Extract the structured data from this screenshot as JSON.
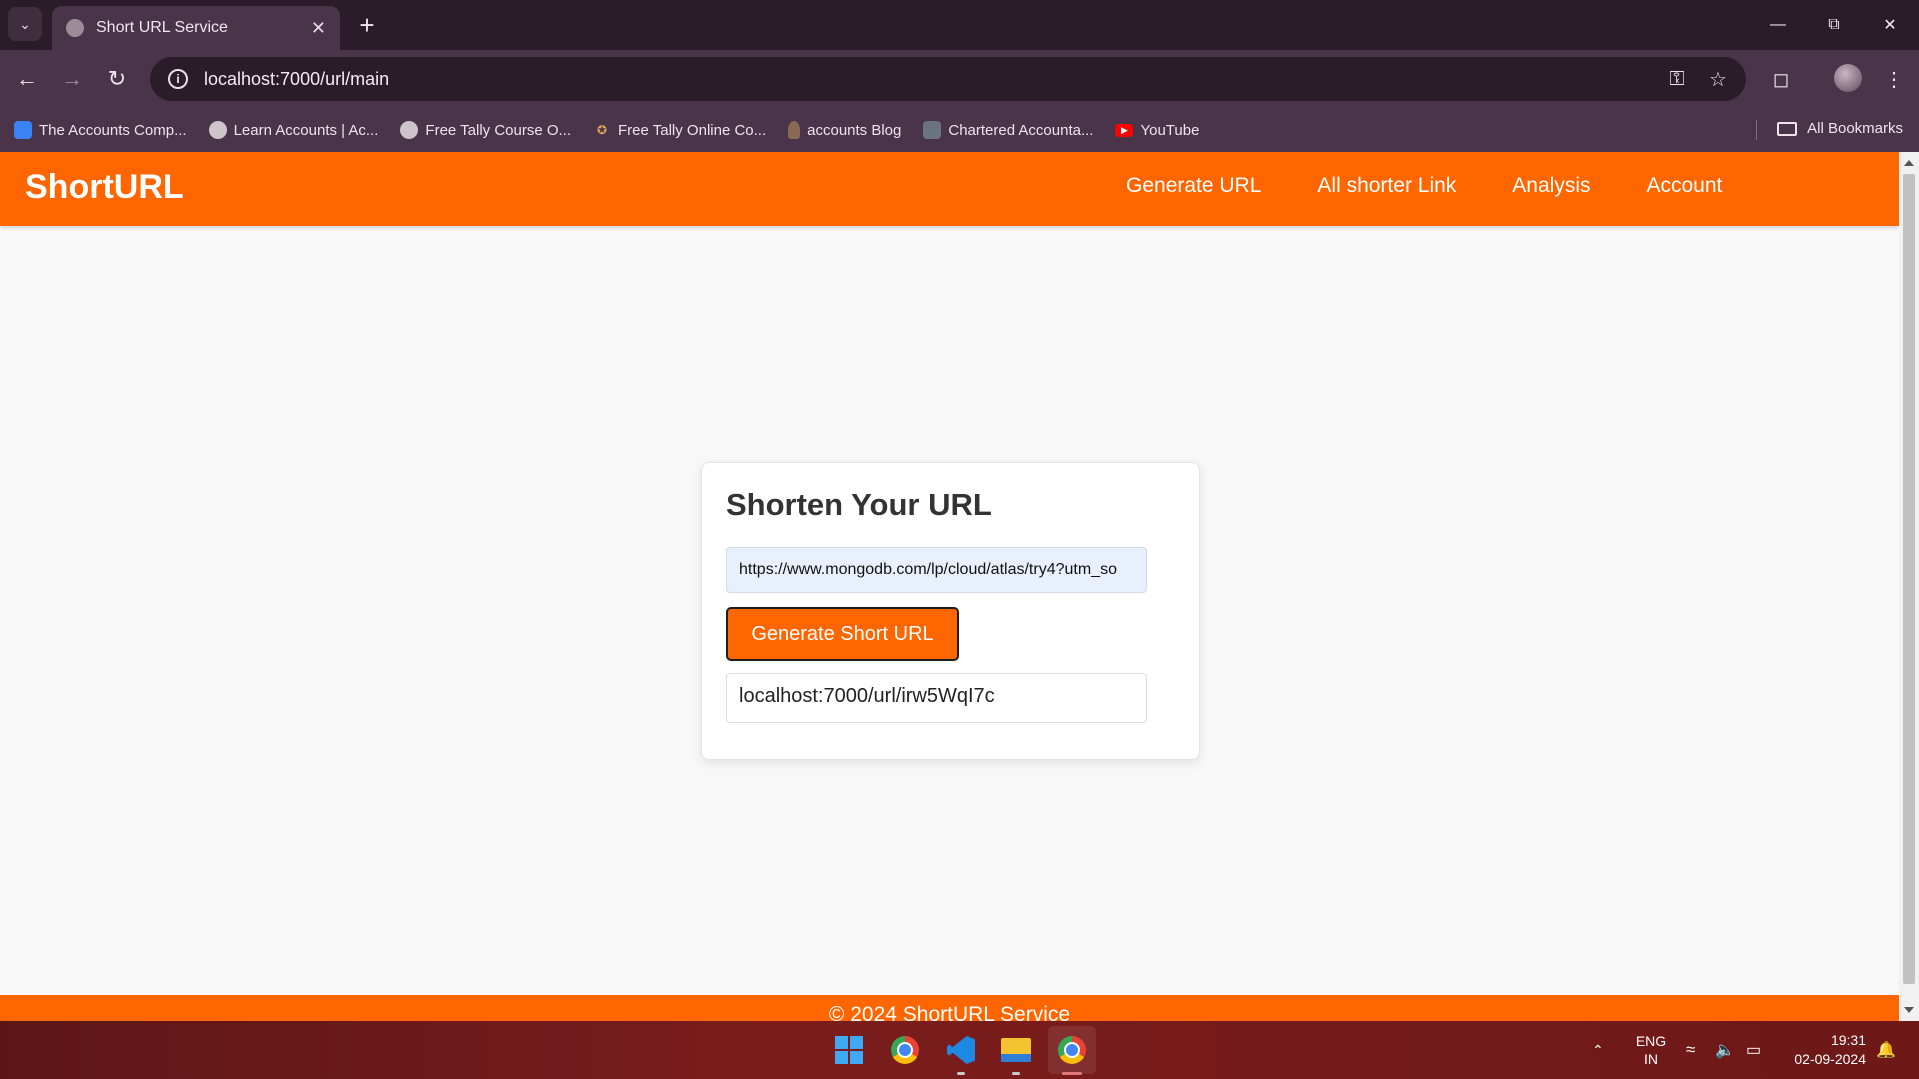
{
  "browser": {
    "tab_title": "Short URL Service",
    "tab_close": "✕",
    "new_tab": "+",
    "address": "localhost:7000/url/main",
    "bookmarks": [
      {
        "label": "The Accounts Comp...",
        "icon": "accounts-icon",
        "color": "#3b82f6"
      },
      {
        "label": "Learn Accounts | Ac...",
        "icon": "globe-icon",
        "color": "#cfc3cc"
      },
      {
        "label": "Free Tally Course O...",
        "icon": "globe-icon",
        "color": "#cfc3cc"
      },
      {
        "label": "Free Tally Online Co...",
        "icon": "runner-icon",
        "color": "#e0a85a"
      },
      {
        "label": "accounts Blog",
        "icon": "person-icon",
        "color": "#8a6a55"
      },
      {
        "label": "Chartered Accounta...",
        "icon": "ca-icon",
        "color": "#6b7280"
      },
      {
        "label": "YouTube",
        "icon": "youtube-icon",
        "color": "#ff0000"
      }
    ],
    "all_bookmarks": "All Bookmarks"
  },
  "site": {
    "brand": "ShortURL",
    "brand_color": "#ff6600",
    "nav": [
      "Generate URL",
      "All shorter Link",
      "Analysis",
      "Account"
    ],
    "card": {
      "heading": "Shorten Your URL",
      "url_value": "https://www.mongodb.com/lp/cloud/atlas/try4?utm_so",
      "button_label": "Generate Short URL",
      "short_url": "localhost:7000/url/irw5WqI7c"
    },
    "footer": "© 2024 ShortURL Service"
  },
  "taskbar": {
    "lang_top": "ENG",
    "lang_bottom": "IN",
    "time": "19:31",
    "date": "02-09-2024"
  }
}
